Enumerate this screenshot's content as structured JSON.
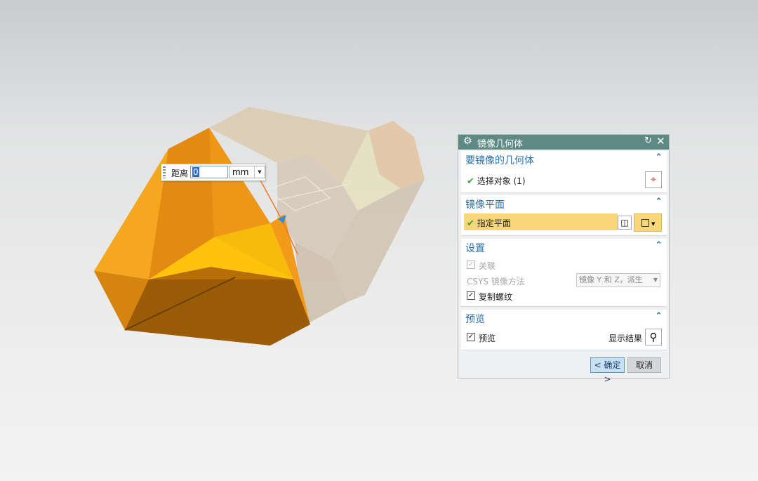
{
  "distance_input": {
    "label": "距离",
    "value": "0",
    "unit": "mm"
  },
  "dialog": {
    "title": "镜像几何体",
    "sections": {
      "geometry": {
        "header": "要镜像的几何体",
        "select_object_label": "选择对象 (1)"
      },
      "plane": {
        "header": "镜像平面",
        "specify_plane_label": "指定平面"
      },
      "settings": {
        "header": "设置",
        "associative_label": "关联",
        "csys_method_label": "CSYS 镜像方法",
        "csys_method_value": "镜像 Y 和 Z，派生",
        "copy_threads_label": "复制螺纹"
      },
      "preview": {
        "header": "预览",
        "preview_label": "预览",
        "show_result_label": "显示结果"
      }
    },
    "ok_label": "< 确定 >",
    "cancel_label": "取消"
  },
  "colors": {
    "accent": "#5f8a84",
    "header_text": "#2a6fa8",
    "highlight": "#f8d77a",
    "model_orange": "#f0a21c"
  }
}
